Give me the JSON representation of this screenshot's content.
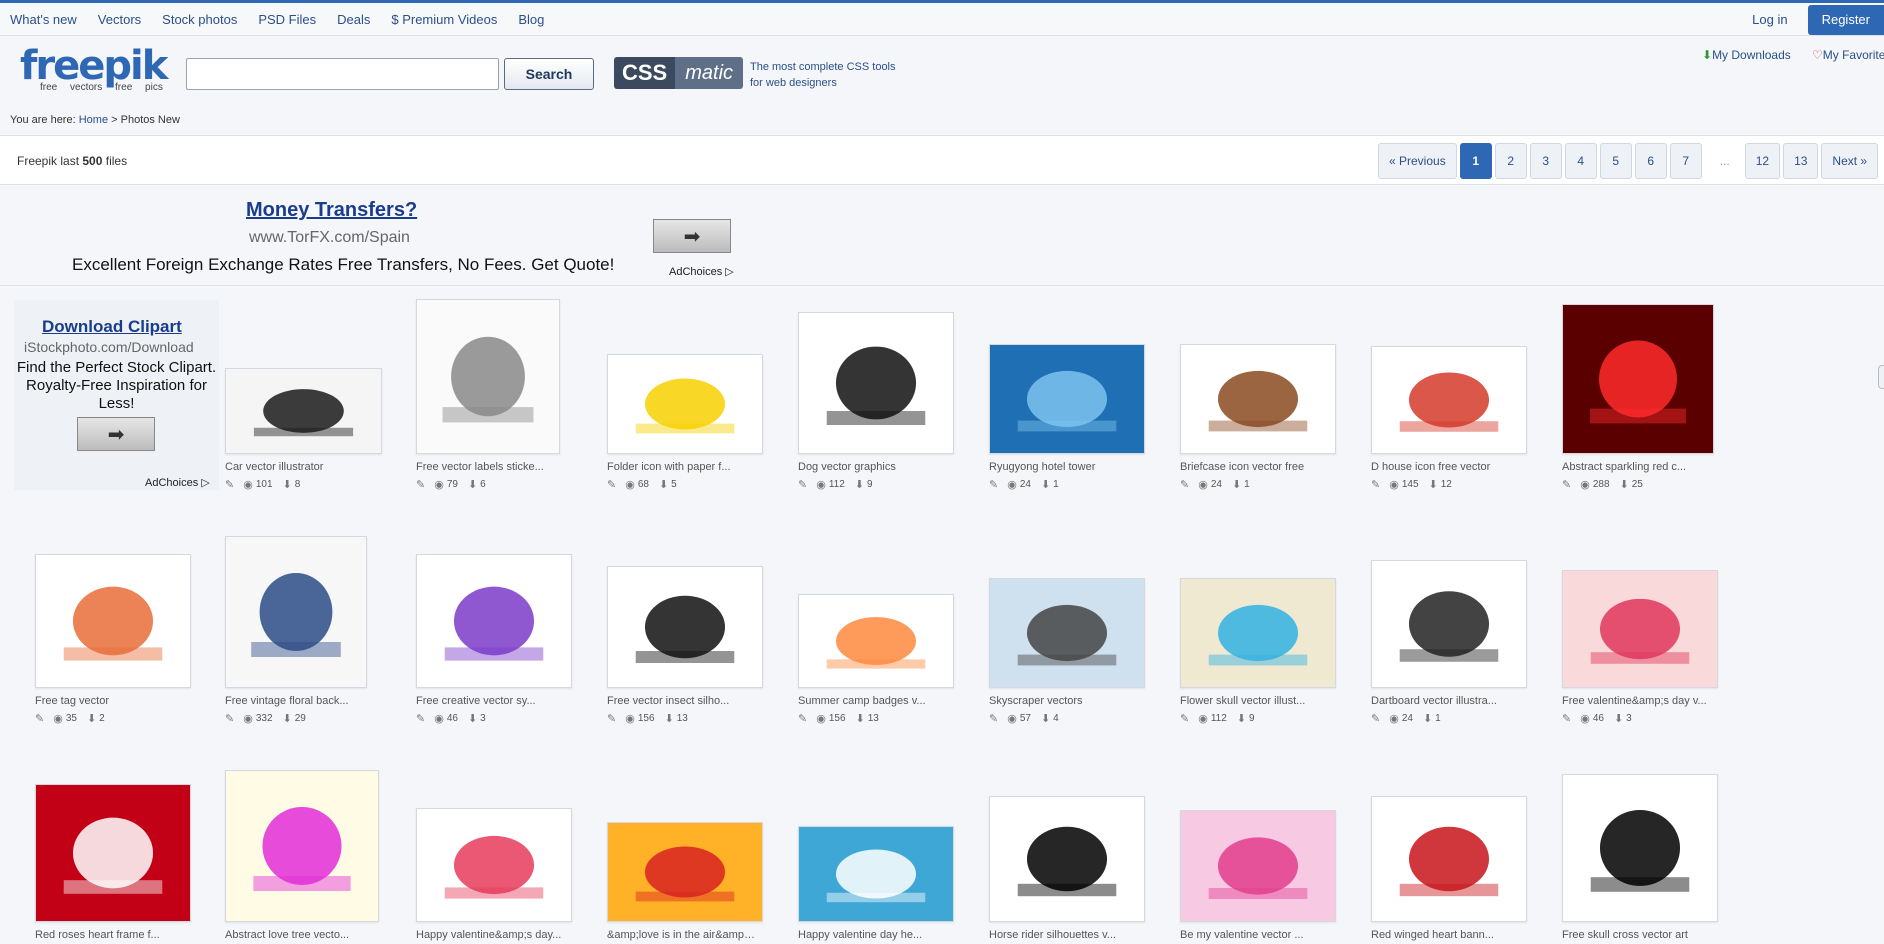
{
  "topnav": {
    "links": [
      "What's new",
      "Vectors",
      "Stock photos",
      "PSD Files",
      "Deals",
      "$ Premium Videos",
      "Blog"
    ],
    "login": "Log in",
    "register": "Register"
  },
  "header": {
    "logo_word": "freepik",
    "logo_tag": "free vectors free pics",
    "search_button": "Search",
    "search_value": "",
    "cssmatic_css": "CSS",
    "cssmatic_matic": "matic",
    "cssmatic_line1": "The most complete CSS tools",
    "cssmatic_line2": "for web designers",
    "my_downloads": "My Downloads",
    "my_favorites": "My Favorites"
  },
  "breadcrumb": {
    "prefix": "You are here:",
    "home": "Home",
    "sep": ">",
    "current": "Photos New"
  },
  "filebar": {
    "count_prefix": "Freepik last",
    "count_num": "500",
    "count_suffix": "files",
    "pager": [
      "« Previous",
      "1",
      "2",
      "3",
      "4",
      "5",
      "6",
      "7",
      "...",
      "12",
      "13",
      "Next »"
    ],
    "active_page": "1"
  },
  "ads": {
    "top_title": "Money Transfers?",
    "top_url": "www.TorFX.com/Spain",
    "top_text": "Excellent Foreign Exchange Rates Free Transfers, No Fees. Get Quote!",
    "adchoices": "AdChoices",
    "side_title": "Download Clipart",
    "side_url": "iStockphoto.com/Download",
    "side_text": "Find the Perfect Stock Clipart. Royalty-Free Inspiration for Less!"
  },
  "icons": {
    "pen": "pen-icon",
    "eye": "eye-icon",
    "download": "download-arrow-icon",
    "arrow": "arrow-right-icon"
  },
  "rows": [
    [
      {
        "title": "Car vector illustrator",
        "views": "101",
        "downloads": "8"
      },
      {
        "title": "Free vector labels sticke...",
        "views": "79",
        "downloads": "6"
      },
      {
        "title": "Folder icon with paper f...",
        "views": "68",
        "downloads": "5"
      },
      {
        "title": "Dog vector graphics",
        "views": "112",
        "downloads": "9"
      },
      {
        "title": "Ryugyong hotel tower",
        "views": "24",
        "downloads": "1"
      },
      {
        "title": "Briefcase icon vector free",
        "views": "24",
        "downloads": "1"
      },
      {
        "title": "D house icon free vector",
        "views": "145",
        "downloads": "12"
      },
      {
        "title": "Abstract sparkling red c...",
        "views": "288",
        "downloads": "25"
      }
    ],
    [
      {
        "title": "Free tag vector",
        "views": "35",
        "downloads": "2"
      },
      {
        "title": "Free vintage floral back...",
        "views": "332",
        "downloads": "29"
      },
      {
        "title": "Free creative vector sy...",
        "views": "46",
        "downloads": "3"
      },
      {
        "title": "Free vector insect silho...",
        "views": "156",
        "downloads": "13"
      },
      {
        "title": "Summer camp badges v...",
        "views": "156",
        "downloads": "13"
      },
      {
        "title": "Skyscraper vectors",
        "views": "57",
        "downloads": "4"
      },
      {
        "title": "Flower skull vector illust...",
        "views": "112",
        "downloads": "9"
      },
      {
        "title": "Dartboard vector illustra...",
        "views": "24",
        "downloads": "1"
      },
      {
        "title": "Free valentine&amp;s day v...",
        "views": "46",
        "downloads": "3"
      }
    ],
    [
      {
        "title": "Red roses heart frame f...",
        "views": "",
        "downloads": ""
      },
      {
        "title": "Abstract love tree vecto...",
        "views": "",
        "downloads": ""
      },
      {
        "title": "Happy valentine&amp;s day...",
        "views": "",
        "downloads": ""
      },
      {
        "title": "&amp;love is in the air&amp; ve...",
        "views": "",
        "downloads": ""
      },
      {
        "title": "Happy valentine day he...",
        "views": "",
        "downloads": ""
      },
      {
        "title": "Horse rider silhouettes v...",
        "views": "",
        "downloads": ""
      },
      {
        "title": "Be my valentine vector ...",
        "views": "",
        "downloads": ""
      },
      {
        "title": "Red winged heart bann...",
        "views": "",
        "downloads": ""
      },
      {
        "title": "Free skull cross vector art",
        "views": "",
        "downloads": ""
      }
    ]
  ]
}
